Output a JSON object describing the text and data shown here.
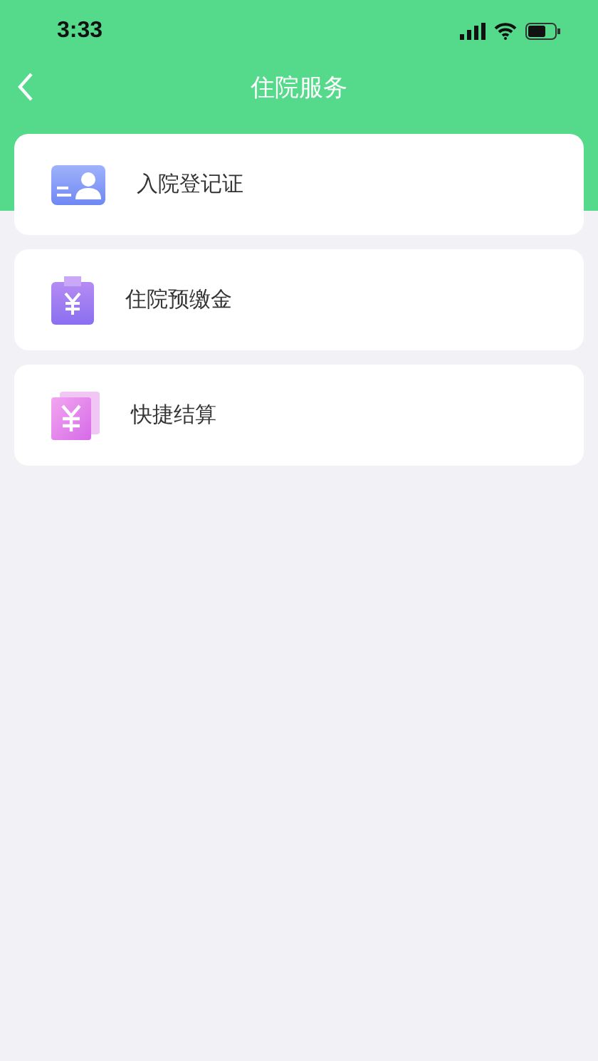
{
  "status_bar": {
    "time": "3:33"
  },
  "nav": {
    "title": "住院服务"
  },
  "items": [
    {
      "kind": "id-card",
      "label": "入院登记证"
    },
    {
      "kind": "clipboard",
      "label": "住院预缴金"
    },
    {
      "kind": "bill",
      "label": "快捷结算"
    }
  ]
}
